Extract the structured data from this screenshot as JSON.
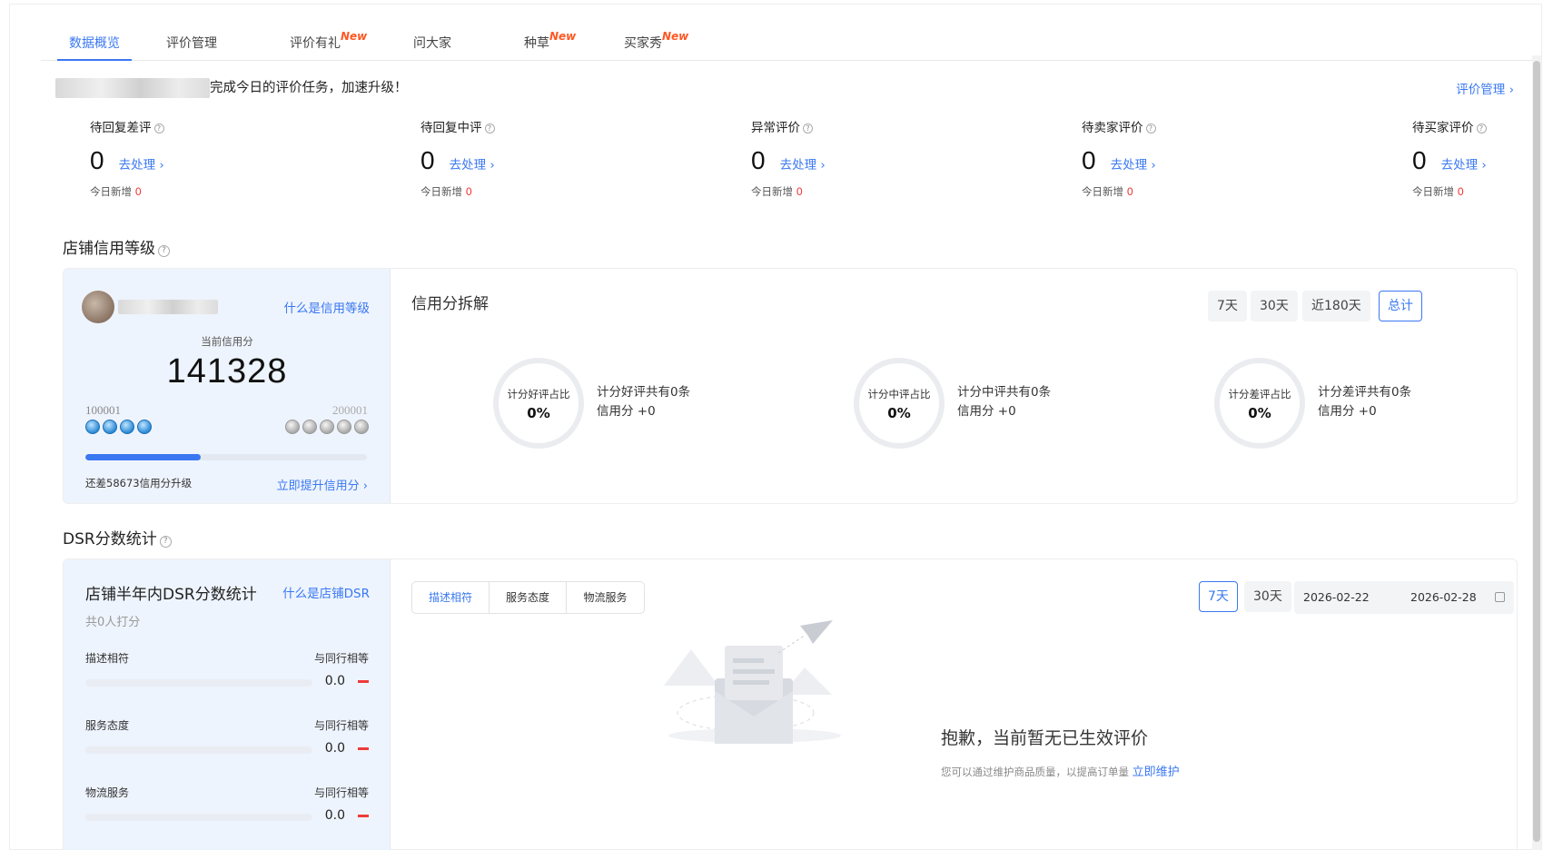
{
  "tabs": [
    {
      "label": "数据概览",
      "badge": ""
    },
    {
      "label": "评价管理",
      "badge": ""
    },
    {
      "label": "评价有礼",
      "badge": "New"
    },
    {
      "label": "问大家",
      "badge": ""
    },
    {
      "label": "种草",
      "badge": "New"
    },
    {
      "label": "买家秀",
      "badge": "New"
    }
  ],
  "banner": {
    "text": "完成今日的评价任务，加速升级！",
    "manage_link": "评价管理 ›"
  },
  "stats": [
    {
      "title": "待回复差评",
      "value": "0",
      "action": "去处理 ›",
      "sub_label": "今日新增",
      "sub_value": "0"
    },
    {
      "title": "待回复中评",
      "value": "0",
      "action": "去处理 ›",
      "sub_label": "今日新增",
      "sub_value": "0"
    },
    {
      "title": "异常评价",
      "value": "0",
      "action": "去处理 ›",
      "sub_label": "今日新增",
      "sub_value": "0"
    },
    {
      "title": "待卖家评价",
      "value": "0",
      "action": "去处理 ›",
      "sub_label": "今日新增",
      "sub_value": "0"
    },
    {
      "title": "待买家评价",
      "value": "0",
      "action": "去处理 ›",
      "sub_label": "今日新增",
      "sub_value": "0"
    }
  ],
  "credit": {
    "section_title": "店铺信用等级",
    "what_link": "什么是信用等级",
    "current_label": "当前信用分",
    "current_value": "141328",
    "level_min": "100001",
    "level_max": "200001",
    "progress_fraction": 0.41,
    "gap_text": "还差58673信用分升级",
    "upgrade_link": "立即提升信用分 ›",
    "breakdown_title": "信用分拆解",
    "ranges": [
      "7天",
      "30天",
      "近180天",
      "总计"
    ],
    "active_range": "总计",
    "rings": [
      {
        "label": "计分好评占比",
        "value": "0%",
        "line1": "计分好评共有0条",
        "line2": "信用分 +0"
      },
      {
        "label": "计分中评占比",
        "value": "0%",
        "line1": "计分中评共有0条",
        "line2": "信用分 +0"
      },
      {
        "label": "计分差评占比",
        "value": "0%",
        "line1": "计分差评共有0条",
        "line2": "信用分 +0"
      }
    ]
  },
  "dsr": {
    "section_title": "DSR分数统计",
    "card_title": "店铺半年内DSR分数统计",
    "what_link": "什么是店铺DSR",
    "count_text": "共0人打分",
    "rows": [
      {
        "name": "描述相符",
        "compare": "与同行相等",
        "score": "0.0"
      },
      {
        "name": "服务态度",
        "compare": "与同行相等",
        "score": "0.0"
      },
      {
        "name": "物流服务",
        "compare": "与同行相等",
        "score": "0.0"
      }
    ],
    "segments": [
      "描述相符",
      "服务态度",
      "物流服务"
    ],
    "ranges": [
      "7天",
      "30天"
    ],
    "date_start": "2026-02-22",
    "date_end": "2026-02-28",
    "empty_title": "抱歉，当前暂无已生效评价",
    "empty_sub": "您可以通过维护商品质量，以提高订单量",
    "empty_link": "立即维护"
  },
  "colors": {
    "accent": "#3a78f2",
    "new_badge": "#ff5722",
    "alert": "#f03a3a"
  }
}
